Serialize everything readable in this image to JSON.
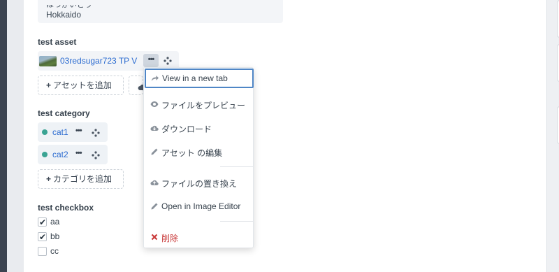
{
  "address": {
    "prefecture_kana": "ほっかいどう",
    "prefecture": "Hokkaido"
  },
  "asset_field": {
    "label": "test asset",
    "asset_name": "03redsugar723 TP V",
    "more_label": "•••",
    "add_button": "アセットを追加",
    "plus": "+"
  },
  "context_menu": {
    "items": [
      {
        "label": "View in a new tab",
        "icon": "share-arrow-icon"
      },
      {
        "label": "ファイルをプレビュー",
        "icon": "eye-icon"
      },
      {
        "label": "ダウンロード",
        "icon": "cloud-download-icon"
      },
      {
        "label": "アセット の編集",
        "icon": "pencil-icon"
      },
      {
        "label": "ファイルの置き換え",
        "icon": "cloud-upload-icon"
      },
      {
        "label": "Open in Image Editor",
        "icon": "pencil-icon"
      },
      {
        "label": "削除",
        "icon": "x-icon"
      }
    ]
  },
  "category_field": {
    "label": "test category",
    "categories": [
      "cat1",
      "cat2"
    ],
    "more_label": "•••",
    "add_button": "カテゴリを追加",
    "plus": "+",
    "dot_color": "#3aa393"
  },
  "checkbox_field": {
    "label": "test checkbox",
    "options": [
      {
        "label": "aa",
        "checked": true
      },
      {
        "label": "bb",
        "checked": true
      },
      {
        "label": "cc",
        "checked": false
      }
    ]
  },
  "colors": {
    "link": "#2b6bd0",
    "danger": "#c93a3a",
    "focus": "#4f86c6"
  }
}
